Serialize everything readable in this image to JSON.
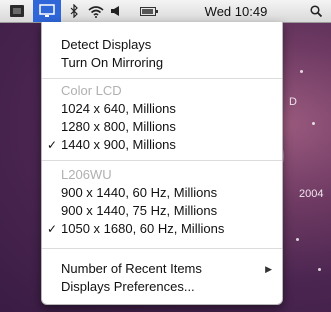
{
  "menubar": {
    "clock": "Wed 10:49"
  },
  "desktop": {
    "label_right": "D",
    "year": "2004"
  },
  "menu": {
    "items": [
      {
        "label": "Detect Displays"
      },
      {
        "label": "Turn On Mirroring"
      }
    ],
    "section1_header": "Color LCD",
    "section1_items": [
      {
        "label": "1024 x 640, Millions",
        "checked": false
      },
      {
        "label": "1280 x 800, Millions",
        "checked": false
      },
      {
        "label": "1440 x 900, Millions",
        "checked": true
      }
    ],
    "section2_header": "L206WU",
    "section2_items": [
      {
        "label": "900 x 1440, 60 Hz, Millions",
        "checked": false
      },
      {
        "label": "900 x 1440, 75 Hz, Millions",
        "checked": false
      },
      {
        "label": "1050 x 1680, 60 Hz, Millions",
        "checked": true
      }
    ],
    "footer_items": [
      {
        "label": "Number of Recent Items",
        "submenu": true
      },
      {
        "label": "Displays Preferences..."
      }
    ],
    "check_glyph": "✓",
    "submenu_glyph": "▶"
  }
}
